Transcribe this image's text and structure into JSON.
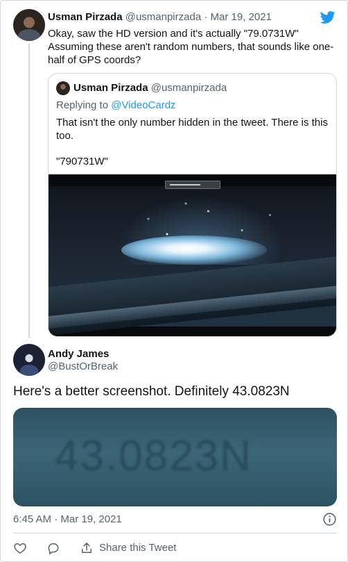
{
  "parent_tweet": {
    "name": "Usman Pirzada",
    "handle": "@usmanpirzada",
    "separator": "·",
    "date": "Mar 19, 2021",
    "text": "Okay, saw the HD version and it's actually \"79.0731W\" Assuming these aren't random numbers, that sounds like one-half of GPS coords?"
  },
  "quoted_tweet": {
    "name": "Usman Pirzada",
    "handle": "@usmanpirzada",
    "replying_prefix": "Replying to ",
    "replying_to": "@VideoCardz",
    "text": "That isn't the only number hidden in the tweet. There is this too.",
    "code": "\"790731W\"",
    "media_icon": "video-screenshot-glowing-object"
  },
  "reply_tweet": {
    "name": "Andy James",
    "handle": "@BustOrBreak",
    "text": "Here's a better screenshot. Definitely 43.0823N",
    "media_text": "43.0823N",
    "time": "6:45 AM",
    "separator": "·",
    "date": "Mar 19, 2021"
  },
  "actions": {
    "like_icon": "heart-icon",
    "reply_icon": "speech-bubble-icon",
    "share_icon": "share-icon",
    "share_label": "Share this Tweet"
  },
  "colors": {
    "brand": "#1d9bf0",
    "text": "#0f1419",
    "muted": "#536471",
    "border": "#cfd9de"
  }
}
